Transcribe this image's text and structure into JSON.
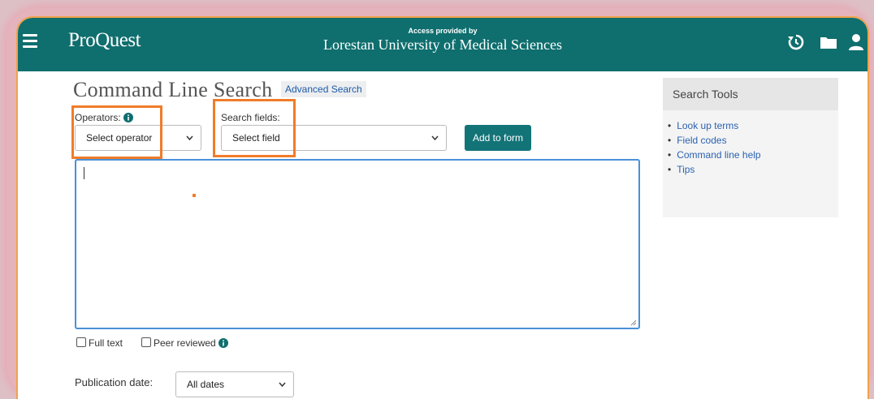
{
  "header": {
    "app_name": "ProQuest",
    "access_prefix": "Access provided by",
    "institution": "Lorestan University of Medical Sciences",
    "icons": [
      "menu-icon",
      "history-icon",
      "folder-icon",
      "user-icon"
    ]
  },
  "page": {
    "title": "Command Line Search",
    "advanced_link": "Advanced Search"
  },
  "form": {
    "operators_label": "Operators:",
    "operator_selected": "Select operator",
    "fields_label": "Search fields:",
    "field_selected": "Select field",
    "add_button": "Add to form",
    "query_value": "",
    "full_text_label": "Full text",
    "peer_reviewed_label": "Peer reviewed",
    "full_text_checked": false,
    "peer_reviewed_checked": false,
    "publication_date_label": "Publication date:",
    "publication_date_selected": "All dates"
  },
  "sidebar": {
    "title": "Search Tools",
    "links": [
      "Look up terms",
      "Field codes",
      "Command line help",
      "Tips"
    ]
  },
  "colors": {
    "header_bg": "#0f6e6e",
    "button_bg": "#137478",
    "link": "#2a62b0",
    "highlight": "#f07c2a"
  }
}
